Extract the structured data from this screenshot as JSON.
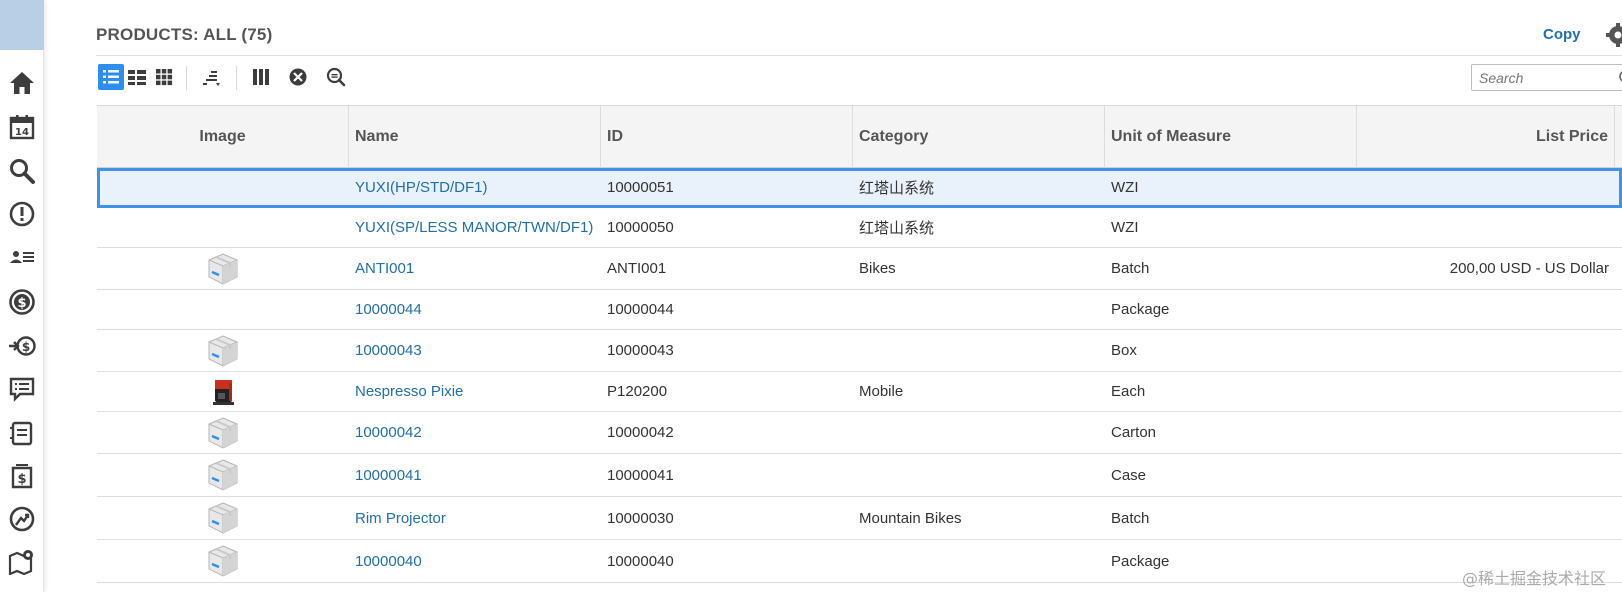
{
  "header": {
    "title": "PRODUCTS: ALL (75)",
    "copy_label": "Copy"
  },
  "search": {
    "placeholder": "Search"
  },
  "sidebar": {
    "icons": [
      "home-icon",
      "calendar-icon",
      "search-icon",
      "alert-icon",
      "contacts-icon",
      "dollar-icon",
      "payment-icon",
      "feedback-icon",
      "document-icon",
      "invoice-icon",
      "upload-icon",
      "map-icon"
    ],
    "calendar_day": "14"
  },
  "toolbar": {
    "buttons": [
      "list-view-icon",
      "compact-view-icon",
      "grid-view-icon",
      "sort-icon",
      "columns-icon",
      "filter-icon",
      "zoom-search-icon"
    ]
  },
  "table": {
    "columns": [
      "Image",
      "Name",
      "ID",
      "Category",
      "Unit of Measure",
      "List Price"
    ],
    "rows": [
      {
        "image": "",
        "name": "YUXI(HP/STD/DF1)",
        "id": "10000051",
        "category": "红塔山系统",
        "uom": "WZI",
        "price": ""
      },
      {
        "image": "",
        "name": "YUXI(SP/LESS MANOR/TWN/DF1)",
        "id": "10000050",
        "category": "红塔山系统",
        "uom": "WZI",
        "price": ""
      },
      {
        "image": "box",
        "name": "ANTI001",
        "id": "ANTI001",
        "category": "Bikes",
        "uom": "Batch",
        "price": "200,00 USD - US Dollar"
      },
      {
        "image": "",
        "name": "10000044",
        "id": "10000044",
        "category": "",
        "uom": "Package",
        "price": ""
      },
      {
        "image": "box",
        "name": "10000043",
        "id": "10000043",
        "category": "",
        "uom": "Box",
        "price": ""
      },
      {
        "image": "coffee",
        "name": "Nespresso Pixie",
        "id": "P120200",
        "category": "Mobile",
        "uom": "Each",
        "price": ""
      },
      {
        "image": "box",
        "name": "10000042",
        "id": "10000042",
        "category": "",
        "uom": "Carton",
        "price": ""
      },
      {
        "image": "box",
        "name": "10000041",
        "id": "10000041",
        "category": "",
        "uom": "Case",
        "price": ""
      },
      {
        "image": "box",
        "name": "Rim Projector",
        "id": "10000030",
        "category": "Mountain Bikes",
        "uom": "Batch",
        "price": ""
      },
      {
        "image": "box",
        "name": "10000040",
        "id": "10000040",
        "category": "",
        "uom": "Package",
        "price": ""
      }
    ]
  },
  "watermark": "@稀土掘金技术社区",
  "colors": {
    "accent": "#2b8ef0",
    "link": "#1f6fa8",
    "selected_row": "#e9f1fb",
    "sidebar_top": "#b9cfe6"
  }
}
